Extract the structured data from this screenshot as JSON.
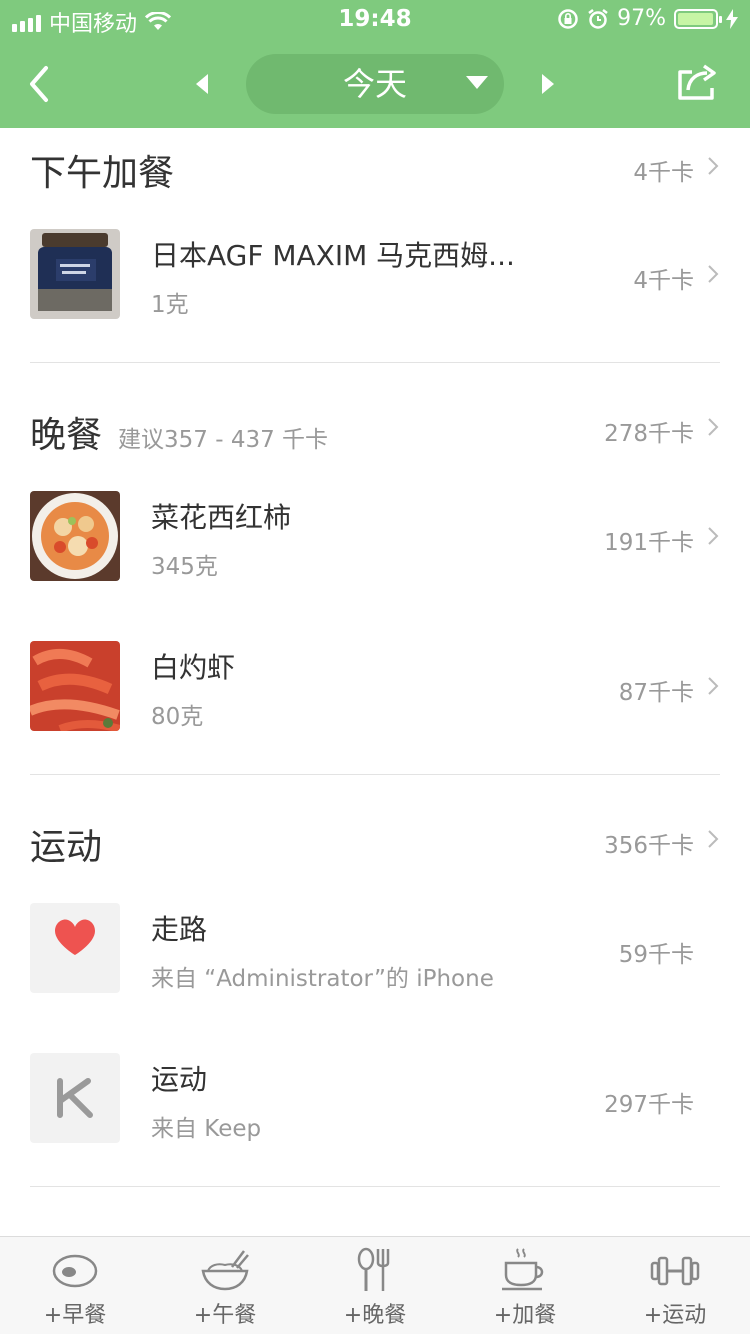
{
  "status_bar": {
    "carrier": "中国移动",
    "time": "19:48",
    "battery": "97%",
    "battery_level": 0.97
  },
  "nav": {
    "date_label": "今天"
  },
  "sections": {
    "snack_afternoon": {
      "title": "下午加餐",
      "total": "4千卡",
      "items": [
        {
          "name": "日本AGF MAXIM 马克西姆...",
          "amount": "1克",
          "kcal": "4千卡"
        }
      ]
    },
    "dinner": {
      "title": "晚餐",
      "hint": "建议357 - 437 千卡",
      "total": "278千卡",
      "items": [
        {
          "name": "菜花西红柿",
          "amount": "345克",
          "kcal": "191千卡"
        },
        {
          "name": "白灼虾",
          "amount": "80克",
          "kcal": "87千卡"
        }
      ]
    },
    "exercise": {
      "title": "运动",
      "total": "356千卡",
      "items": [
        {
          "name": "走路",
          "source": "来自 “Administrator”的 iPhone",
          "kcal": "59千卡"
        },
        {
          "name": "运动",
          "source": "来自 Keep",
          "kcal": "297千卡"
        }
      ]
    }
  },
  "tabbar": {
    "items": [
      {
        "label": "+早餐",
        "icon": "egg-icon"
      },
      {
        "label": "+午餐",
        "icon": "bowl-icon"
      },
      {
        "label": "+晚餐",
        "icon": "spoon-fork-icon"
      },
      {
        "label": "+加餐",
        "icon": "coffee-cup-icon"
      },
      {
        "label": "+运动",
        "icon": "dumbbell-icon"
      }
    ]
  },
  "colors": {
    "header_green": "#7fca7e",
    "pill_green": "#70b96f",
    "heart_red": "#ee5350"
  }
}
